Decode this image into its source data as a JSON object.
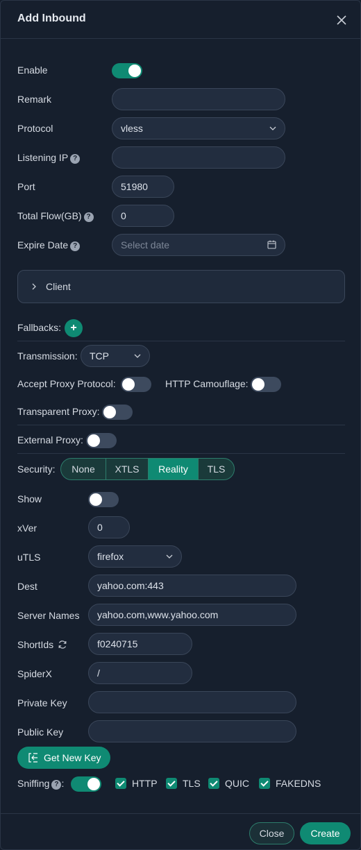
{
  "dialog": {
    "title": "Add Inbound"
  },
  "form": {
    "enable": {
      "label": "Enable",
      "on": true
    },
    "remark": {
      "label": "Remark",
      "value": ""
    },
    "protocol": {
      "label": "Protocol",
      "value": "vless"
    },
    "listening_ip": {
      "label": "Listening IP",
      "value": ""
    },
    "port": {
      "label": "Port",
      "value": "51980"
    },
    "total_flow": {
      "label": "Total Flow(GB)",
      "value": "0"
    },
    "expire_date": {
      "label": "Expire Date",
      "placeholder": "Select date"
    }
  },
  "client": {
    "label": "Client"
  },
  "fallbacks": {
    "label": "Fallbacks:",
    "plus": "+"
  },
  "transmission": {
    "label": "Transmission:",
    "value": "TCP"
  },
  "accept_proxy": {
    "label": "Accept Proxy Protocol:",
    "on": false
  },
  "http_camouflage": {
    "label": "HTTP Camouflage:",
    "on": false
  },
  "transparent_proxy": {
    "label": "Transparent Proxy:",
    "on": false
  },
  "external_proxy": {
    "label": "External Proxy:",
    "on": false
  },
  "security": {
    "label": "Security:",
    "options": [
      "None",
      "XTLS",
      "Reality",
      "TLS"
    ],
    "selected": "Reality"
  },
  "reality": {
    "show": {
      "label": "Show",
      "on": false
    },
    "xver": {
      "label": "xVer",
      "value": "0"
    },
    "utls": {
      "label": "uTLS",
      "value": "firefox"
    },
    "dest": {
      "label": "Dest",
      "value": "yahoo.com:443"
    },
    "server_names": {
      "label": "Server Names",
      "value": "yahoo.com,www.yahoo.com"
    },
    "short_ids": {
      "label": "ShortIds",
      "value": "f0240715"
    },
    "spider_x": {
      "label": "SpiderX",
      "value": "/"
    },
    "private_key": {
      "label": "Private Key",
      "value": ""
    },
    "public_key": {
      "label": "Public Key",
      "value": ""
    },
    "get_new_key": {
      "label": "Get New Key"
    }
  },
  "sniffing": {
    "label": "Sniffing",
    "colon": ":",
    "on": true,
    "options": [
      {
        "label": "HTTP",
        "checked": true
      },
      {
        "label": "TLS",
        "checked": true
      },
      {
        "label": "QUIC",
        "checked": true
      },
      {
        "label": "FAKEDNS",
        "checked": true
      }
    ]
  },
  "footer": {
    "close_label": "Close",
    "create_label": "Create"
  },
  "help_glyph": "?",
  "colors": {
    "accent": "#0f8a73",
    "background": "#161f2d",
    "input_bg": "#222d3f"
  }
}
